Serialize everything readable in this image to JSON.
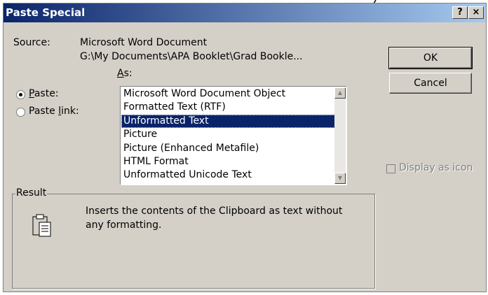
{
  "window": {
    "title": "Paste Special"
  },
  "titlebar": {
    "help_label": "?",
    "close_label": "×"
  },
  "source": {
    "label": "Source:",
    "line1": "Microsoft Word Document",
    "line2": "G:\\My Documents\\APA Booklet\\Grad Bookle..."
  },
  "as_label": "As:",
  "radios": [
    {
      "label": "Paste:",
      "selected": true
    },
    {
      "label": "Paste link:",
      "selected": false
    }
  ],
  "formats": {
    "items": [
      "Microsoft Word Document Object",
      "Formatted Text (RTF)",
      "Unformatted Text",
      "Picture",
      "Picture (Enhanced Metafile)",
      "HTML Format",
      "Unformatted Unicode Text"
    ],
    "selected": "Unformatted Text"
  },
  "buttons": {
    "ok": "OK",
    "cancel": "Cancel"
  },
  "display_as_icon": {
    "label": "Display as icon",
    "checked": false,
    "enabled": false
  },
  "result": {
    "label": "Result",
    "line1": "Inserts the contents of the Clipboard as text without",
    "line2": "any formatting."
  },
  "icons": {
    "result_icon": "clipboard-paste-icon"
  },
  "colors": {
    "titlebar": "#0a246a",
    "selection": "#0a246a",
    "face": "#d4d0c8"
  }
}
